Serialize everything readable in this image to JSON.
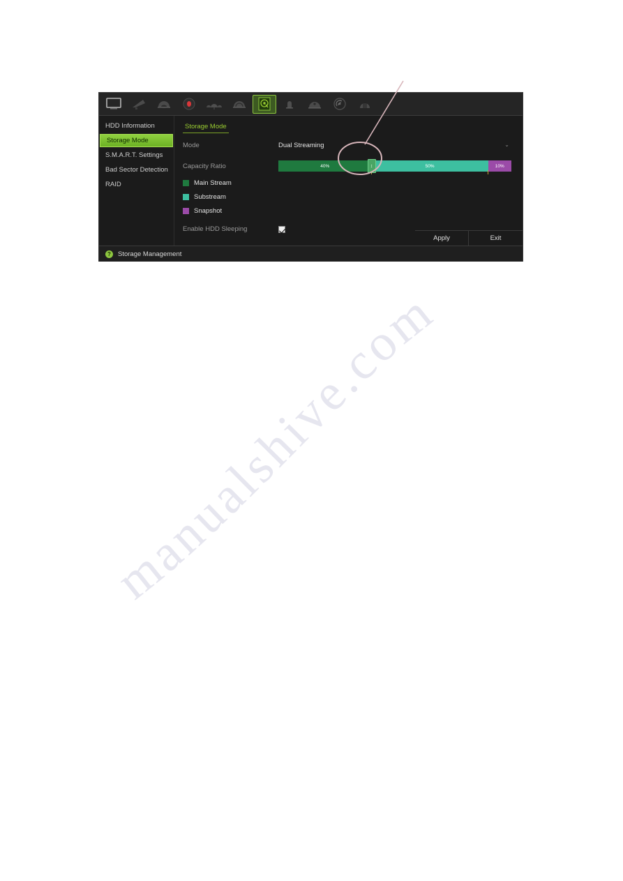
{
  "window": {
    "toolbar": {
      "icons": [
        {
          "name": "monitor-icon",
          "active": false
        },
        {
          "name": "camera-icon",
          "active": false
        },
        {
          "name": "dome-camera-icon",
          "active": false
        },
        {
          "name": "record-icon",
          "active": false
        },
        {
          "name": "multi-camera-icon",
          "active": false
        },
        {
          "name": "dome-network-icon",
          "active": false
        },
        {
          "name": "hdd-storage-icon",
          "active": true
        },
        {
          "name": "alarm-icon",
          "active": false
        },
        {
          "name": "network-dome-icon",
          "active": false
        },
        {
          "name": "wireless-icon",
          "active": false
        },
        {
          "name": "system-icon",
          "active": false
        }
      ]
    },
    "sidebar": {
      "items": [
        {
          "label": "HDD Information",
          "selected": false
        },
        {
          "label": "Storage Mode",
          "selected": true
        },
        {
          "label": "S.M.A.R.T. Settings",
          "selected": false
        },
        {
          "label": "Bad Sector Detection",
          "selected": false
        },
        {
          "label": "RAID",
          "selected": false
        }
      ]
    },
    "content": {
      "tab_label": "Storage Mode",
      "mode": {
        "label": "Mode",
        "value": "Dual Streaming",
        "chevron": "⌄"
      },
      "capacity": {
        "label": "Capacity Ratio",
        "segments": [
          {
            "name": "Main Stream",
            "percent_label": "40%",
            "percent": 40,
            "color": "#1f7a3f"
          },
          {
            "name": "Substream",
            "percent_label": "50%",
            "percent": 50,
            "color": "#3dbfa0"
          },
          {
            "name": "Snapshot",
            "percent_label": "10%",
            "percent": 10,
            "color": "#9b4ba8"
          }
        ],
        "handle_glyph": "↕"
      },
      "legend": [
        {
          "label": "Main Stream",
          "color": "#1f7a3f"
        },
        {
          "label": "Substream",
          "color": "#3dbfa0"
        },
        {
          "label": "Snapshot",
          "color": "#9b4ba8"
        }
      ],
      "sleeping": {
        "label": "Enable HDD Sleeping",
        "checked": true
      },
      "buttons": [
        {
          "label": "Apply",
          "name": "apply-button"
        },
        {
          "label": "Exit",
          "name": "exit-button"
        }
      ]
    },
    "status": {
      "badge": "?",
      "text": "Storage Management"
    }
  },
  "annotation": {
    "highlight_color": "#d8b6bb",
    "type": "callout-ellipse-with-leader-line"
  },
  "watermark": {
    "text": "manualshive.com",
    "color": "#e3e3ef"
  }
}
